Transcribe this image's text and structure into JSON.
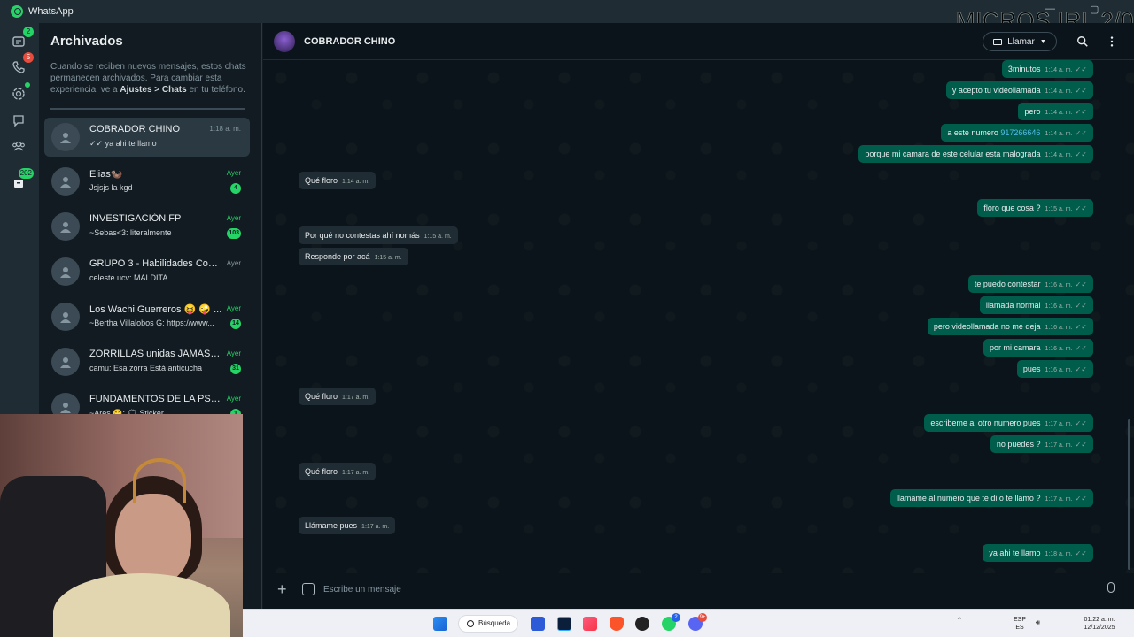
{
  "window": {
    "title": "WhatsApp",
    "overlay_text": "MICROS IRL 2/0"
  },
  "nav": {
    "chats_badge": "2",
    "calls_badge": "5",
    "archived_badge": "202"
  },
  "list": {
    "title": "Archivados",
    "info_prefix": "Cuando se reciben nuevos mensajes, estos chats permanecen archivados. Para cambiar esta experiencia, ve a ",
    "info_bold": "Ajustes > Chats",
    "info_suffix": " en tu teléfono.",
    "chats": [
      {
        "name": "COBRADOR CHINO",
        "time": "1:18 a. m.",
        "preview": "✓✓ ya ahi te llamo",
        "unread": "",
        "active": true
      },
      {
        "name": "Elias🦦",
        "time": "Ayer",
        "preview": "Jsjsjs la kgd",
        "unread": "4",
        "active": false
      },
      {
        "name": "INVESTIGACIÓN FP",
        "time": "Ayer",
        "preview": "~Sebas<3: literalmente",
        "unread": "103",
        "active": false
      },
      {
        "name": "GRUPO 3 - Habilidades Comu...",
        "time": "Ayer",
        "preview": "celeste ucv: MALDITA",
        "unread": "",
        "active": false
      },
      {
        "name": "Los Wachi Guerreros 😝 🤪 ...",
        "time": "Ayer",
        "preview": "~Bertha Villalobos G: https://www...",
        "unread": "14",
        "active": false
      },
      {
        "name": "ZORRILLAS unidas JAMÁS ser...",
        "time": "Ayer",
        "preview": "camu: Esa zorra Está anticucha",
        "unread": "31",
        "active": false
      },
      {
        "name": "FUNDAMENTOS DE LA PSICO...",
        "time": "Ayer",
        "preview": "~Ares 😋: 🗯 Sticker",
        "unread": "1",
        "active": false
      }
    ]
  },
  "conversation": {
    "name": "COBRADOR CHINO",
    "call_label": "Llamar",
    "composer_placeholder": "Escribe un mensaje",
    "messages": [
      {
        "dir": "out",
        "text": "3minutos",
        "time": "1:14 a. m."
      },
      {
        "dir": "out",
        "text": "y acepto tu videollamada",
        "time": "1:14 a. m."
      },
      {
        "dir": "out",
        "text": "pero",
        "time": "1:14 a. m."
      },
      {
        "dir": "out",
        "text": "a este numero ",
        "phone": "917266646",
        "time": "1:14 a. m."
      },
      {
        "dir": "out",
        "text": "porque mi camara de este celular esta malograda",
        "time": "1:14 a. m."
      },
      {
        "dir": "in",
        "text": "Qué floro",
        "time": "1:14 a. m."
      },
      {
        "dir": "out",
        "text": "floro que cosa ?",
        "time": "1:15 a. m."
      },
      {
        "dir": "in",
        "text": "Por qué no contestas ahí nomás",
        "time": "1:15 a. m."
      },
      {
        "dir": "in",
        "text": "Responde por acá",
        "time": "1:15 a. m."
      },
      {
        "dir": "out",
        "text": "te puedo contestar",
        "time": "1:16 a. m."
      },
      {
        "dir": "out",
        "text": "llamada normal",
        "time": "1:16 a. m."
      },
      {
        "dir": "out",
        "text": "pero videollamada no me deja",
        "time": "1:16 a. m."
      },
      {
        "dir": "out",
        "text": "por mi camara",
        "time": "1:16 a. m."
      },
      {
        "dir": "out",
        "text": "pues",
        "time": "1:16 a. m."
      },
      {
        "dir": "in",
        "text": "Qué floro",
        "time": "1:17 a. m."
      },
      {
        "dir": "out",
        "text": "escribeme al otro numero pues",
        "time": "1:17 a. m."
      },
      {
        "dir": "out",
        "text": "no puedes ?",
        "time": "1:17 a. m."
      },
      {
        "dir": "in",
        "text": "Qué floro",
        "time": "1:17 a. m."
      },
      {
        "dir": "out",
        "text": "llamame al numero que te di o te llamo  ?",
        "time": "1:17 a. m."
      },
      {
        "dir": "in",
        "text": "Llámame pues",
        "time": "1:17 a. m."
      },
      {
        "dir": "out",
        "text": "ya ahi te llamo",
        "time": "1:18 a. m."
      }
    ]
  },
  "taskbar": {
    "search_label": "Búsqueda",
    "whatsapp_badge": "2",
    "discord_badge": "9+",
    "lang_top": "ESP",
    "lang_bottom": "ES",
    "clock_time": "01:22 a. m.",
    "clock_date": "12/12/2025"
  },
  "colors": {
    "accent": "#25d366",
    "outgoing_bubble": "#005c4b",
    "incoming_bubble": "#202c33",
    "background": "#0b141a"
  }
}
